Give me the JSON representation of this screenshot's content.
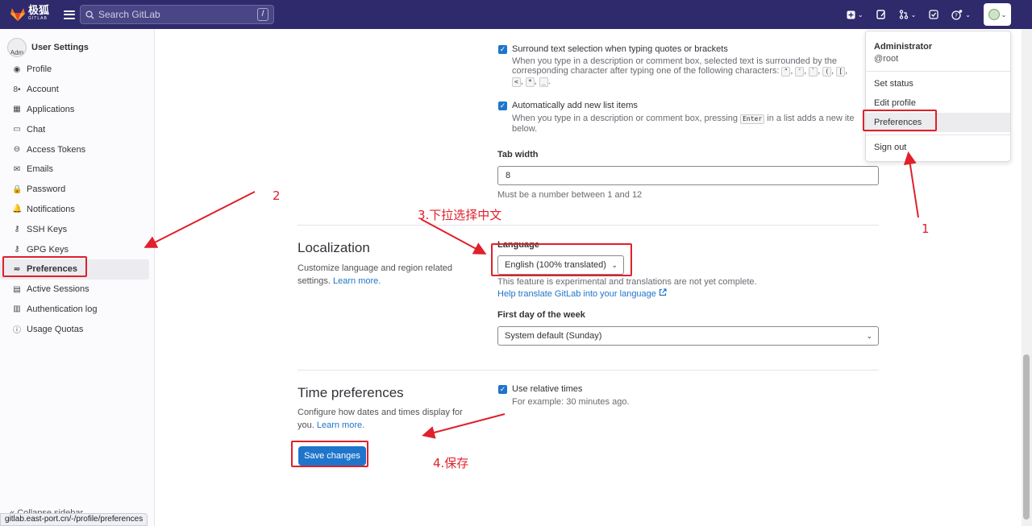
{
  "topbar": {
    "brand": "极狐",
    "brand_sub": "GITLAB",
    "search_placeholder": "Search GitLab",
    "search_shortcut": "/"
  },
  "sidebar": {
    "title": "User Settings",
    "avatar_text": "Adm",
    "items": [
      {
        "label": "Profile",
        "icon": "profile-icon"
      },
      {
        "label": "Account",
        "icon": "account-icon"
      },
      {
        "label": "Applications",
        "icon": "applications-icon"
      },
      {
        "label": "Chat",
        "icon": "chat-icon"
      },
      {
        "label": "Access Tokens",
        "icon": "token-icon"
      },
      {
        "label": "Emails",
        "icon": "mail-icon"
      },
      {
        "label": "Password",
        "icon": "lock-icon"
      },
      {
        "label": "Notifications",
        "icon": "bell-icon"
      },
      {
        "label": "SSH Keys",
        "icon": "key-icon"
      },
      {
        "label": "GPG Keys",
        "icon": "key-icon"
      },
      {
        "label": "Preferences",
        "icon": "preferences-icon"
      },
      {
        "label": "Active Sessions",
        "icon": "sessions-icon"
      },
      {
        "label": "Authentication log",
        "icon": "log-icon"
      },
      {
        "label": "Usage Quotas",
        "icon": "quota-icon"
      }
    ],
    "collapse_label": "Collapse sidebar"
  },
  "statusbar_url": "gitlab.east-port.cn/-/profile/preferences",
  "behavior": {
    "surround_label": "Surround text selection when typing quotes or brackets",
    "surround_help_1": "When you type in a description or comment box, selected text is surrounded by the",
    "surround_help_2": "corresponding character after typing one of the following characters:",
    "surround_chars_1": [
      "\"",
      "'",
      "`",
      "(",
      "["
    ],
    "surround_chars_2": [
      "<",
      "*",
      "_"
    ],
    "autolist_label": "Automatically add new list items",
    "autolist_help_1": "When you type in a description or comment box, pressing",
    "autolist_key": "Enter",
    "autolist_help_2": "in a list adds a new ite",
    "autolist_help_3": "below.",
    "tab_width_label": "Tab width",
    "tab_width_value": "8",
    "tab_width_help": "Must be a number between 1 and 12"
  },
  "localization": {
    "title": "Localization",
    "desc": "Customize language and region related settings.",
    "learn_more": "Learn more.",
    "language_label": "Language",
    "language_value": "English (100% translated)",
    "experimental_note": "This feature is experimental and translations are not yet complete.",
    "help_link": "Help translate GitLab into your language",
    "first_day_label": "First day of the week",
    "first_day_value": "System default (Sunday)"
  },
  "time": {
    "title": "Time preferences",
    "desc": "Configure how dates and times display for you.",
    "learn_more": "Learn more.",
    "relative_label": "Use relative times",
    "relative_help": "For example: 30 minutes ago."
  },
  "save_label": "Save changes",
  "user_menu": {
    "name": "Administrator",
    "username": "@root",
    "items": [
      "Set status",
      "Edit profile",
      "Preferences",
      "Sign out"
    ]
  },
  "annotations": {
    "step1": "1",
    "step2": "2",
    "step3": "3.下拉选择中文",
    "step4": "4.保存"
  },
  "colors": {
    "topbar": "#2f2a6b",
    "primary": "#1f75cb",
    "annotation": "#e0202a"
  }
}
